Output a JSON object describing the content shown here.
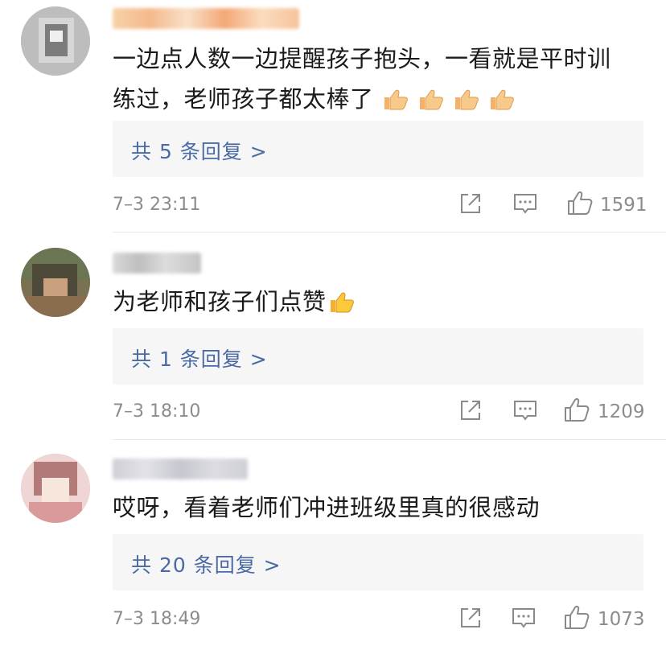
{
  "comments": [
    {
      "text_line1": "一边点人数一边提醒孩子抱头，一看就是平时训",
      "text_line2": "练过，老师孩子都太棒了",
      "replies_label": "共 5 条回复 >",
      "timestamp": "7–3 23:11",
      "like_count": "1591"
    },
    {
      "text_line1": "为老师和孩子们点赞",
      "replies_label": "共 1 条回复 >",
      "timestamp": "7–3 18:10",
      "like_count": "1209"
    },
    {
      "text_line1": "哎呀，看着老师们冲进班级里真的很感动",
      "replies_label": "共 20 条回复 >",
      "timestamp": "7–3 18:49",
      "like_count": "1073"
    }
  ],
  "colors": {
    "reply_link": "#4a6aa5",
    "meta_gray": "#8c8c8c",
    "reply_box": "#f6f6f6"
  },
  "icons": {
    "share": "share-icon",
    "comment": "comment-icon",
    "like": "thumbs-up-icon",
    "emoji": "thumbs-up-emoji"
  }
}
